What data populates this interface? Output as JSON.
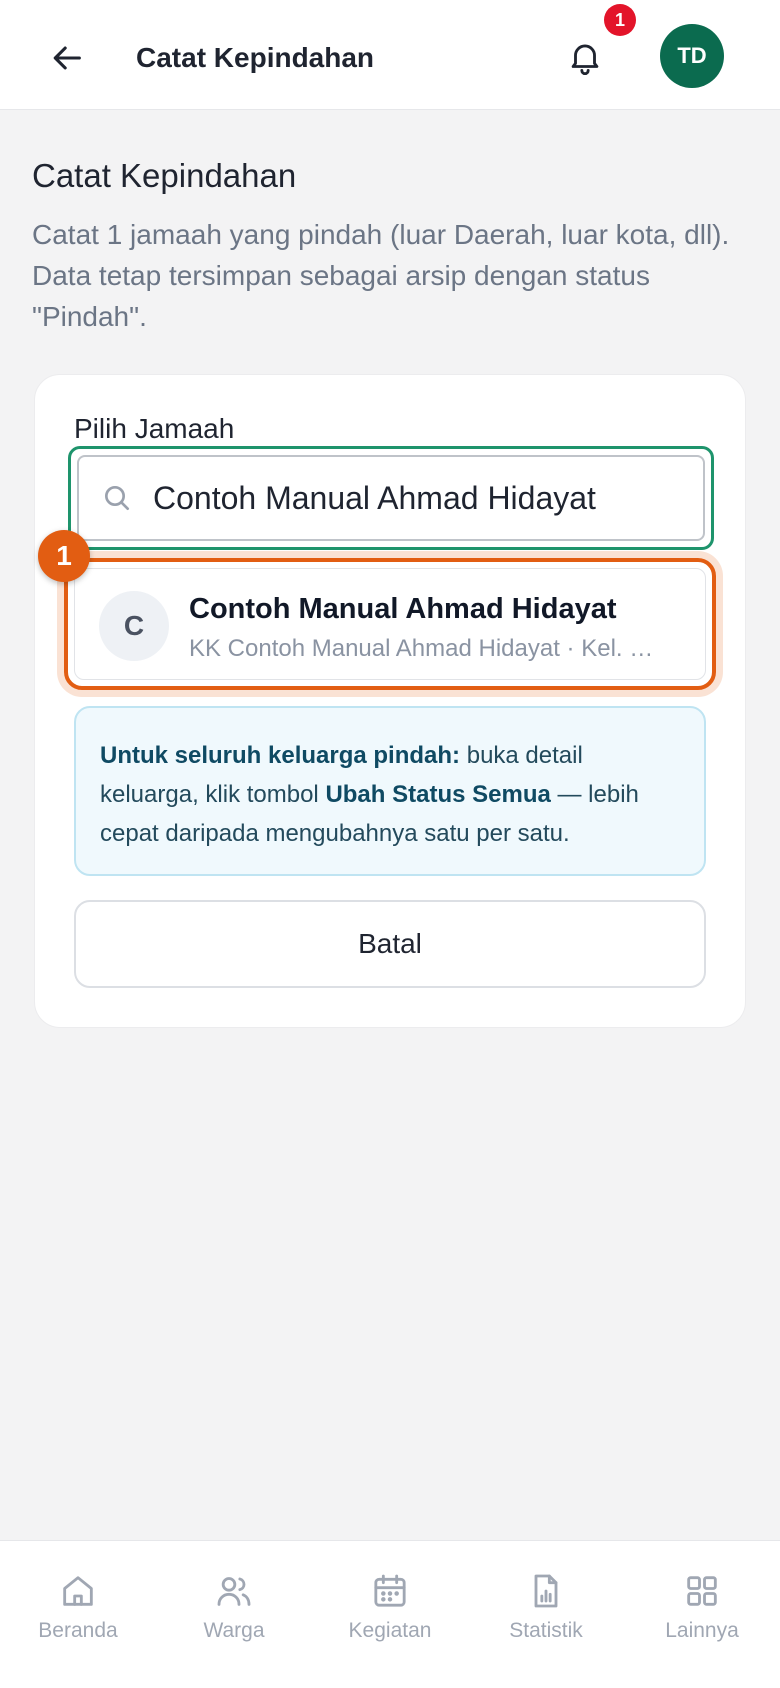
{
  "header": {
    "title": "Catat Kepindahan",
    "notification_count": "1",
    "avatar_initials": "TD"
  },
  "page": {
    "heading": "Catat Kepindahan",
    "description": "Catat 1 jamaah yang pindah (luar Daerah, luar kota, dll). Data tetap tersimpan sebagai arsip dengan status \"Pindah\"."
  },
  "form": {
    "field_label": "Pilih Jamaah",
    "search_value": "Contoh Manual Ahmad Hidayat",
    "step_badge": "1",
    "result": {
      "initial": "C",
      "name": "Contoh Manual Ahmad Hidayat",
      "subtitle": "KK Contoh Manual Ahmad Hidayat · Kel. P..."
    },
    "info": {
      "bold1": "Untuk seluruh keluarga pindah:",
      "text1": " buka detail keluarga, klik tombol ",
      "bold2": "Ubah Status Semua",
      "text2": " — lebih cepat daripada mengubahnya satu per satu."
    },
    "cancel_label": "Batal"
  },
  "bottom_nav": {
    "items": [
      {
        "label": "Beranda",
        "icon": "home-icon"
      },
      {
        "label": "Warga",
        "icon": "users-icon"
      },
      {
        "label": "Kegiatan",
        "icon": "calendar-icon"
      },
      {
        "label": "Statistik",
        "icon": "report-chart-icon"
      },
      {
        "label": "Lainnya",
        "icon": "grid-icon"
      }
    ]
  },
  "colors": {
    "brand_green": "#0b6b4f",
    "focus_green": "#1e946c",
    "highlight_orange": "#e25d12",
    "badge_red": "#e3142a",
    "info_bg": "#f0f9fd"
  }
}
